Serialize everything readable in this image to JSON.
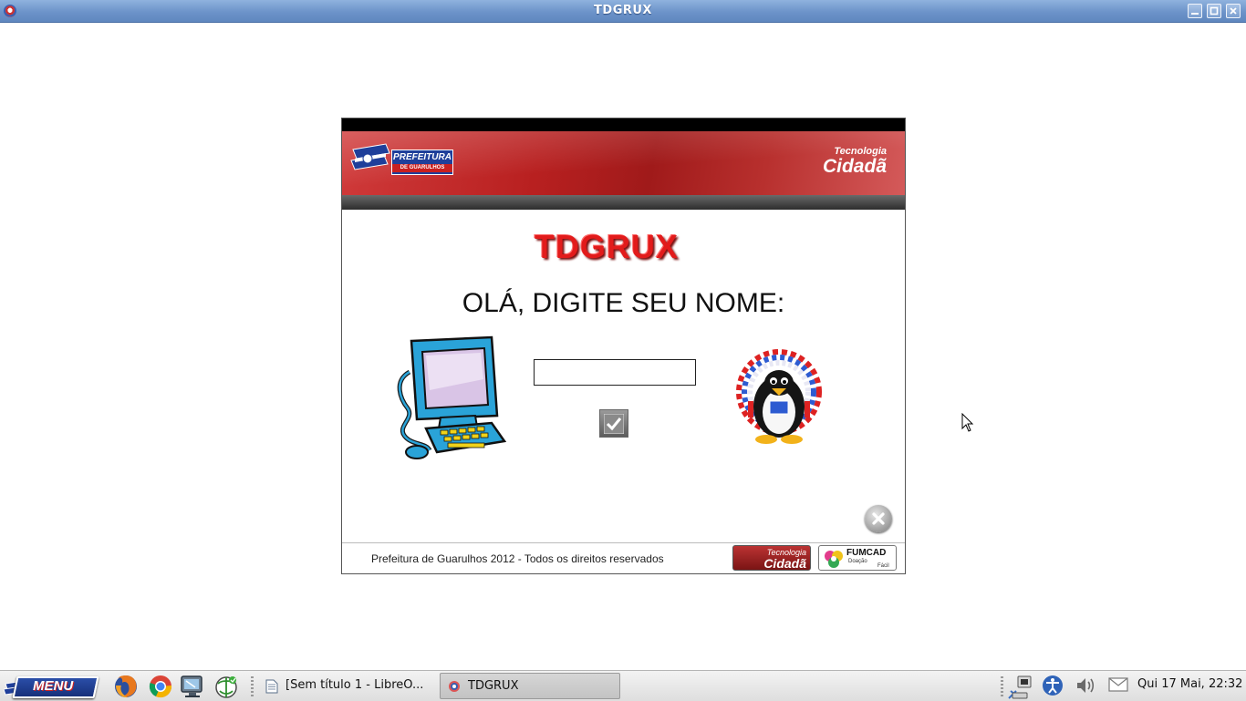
{
  "window": {
    "title": "TDGRUX"
  },
  "dialog": {
    "header_left_logo": {
      "line1": "PREFEITURA",
      "line2": "DE GUARULHOS"
    },
    "header_right_logo": {
      "small": "Tecnologia",
      "big": "Cidadã"
    },
    "app_title": "TDGRUX",
    "prompt": "OLÁ, DIGITE SEU NOME:",
    "name_input": {
      "value": "",
      "placeholder": ""
    },
    "copyright": "Prefeitura de Guarulhos 2012 - Todos os direitos reservados",
    "badge_tecnologia": {
      "small": "Tecnologia",
      "big": "Cidadã"
    },
    "badge_fumcad": {
      "name": "FUMCAD",
      "line2": "Doação",
      "line3": "Fácil"
    }
  },
  "taskbar": {
    "menu_label": "MENU",
    "launchers": [
      "firefox-icon",
      "chrome-icon",
      "monitor-icon",
      "network-icon"
    ],
    "tasks": [
      {
        "label": "[Sem título 1 - LibreO...",
        "active": false
      },
      {
        "label": "TDGRUX",
        "active": true
      }
    ],
    "clock": "Qui 17 Mai, 22:32"
  },
  "colors": {
    "title_bar": "#6c93c9",
    "banner_red": "#b82020",
    "app_title_red": "#e21b1b",
    "taskbar": "#e6e6e6"
  }
}
